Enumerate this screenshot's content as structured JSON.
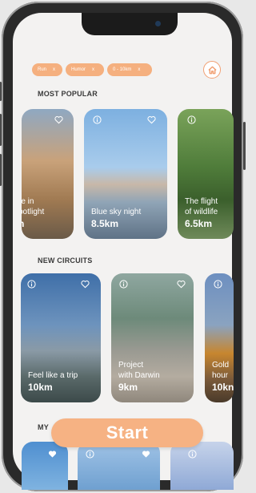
{
  "filters": [
    {
      "label": "Run",
      "x": "x"
    },
    {
      "label": "Humor",
      "x": "x"
    },
    {
      "label": "0 - 10km",
      "x": "x"
    }
  ],
  "sections": {
    "most_popular": "MOST POPULAR",
    "new_circuits": "NEW CIRCUITS",
    "my_partial": "MY"
  },
  "popular": [
    {
      "title_line1": "re in",
      "title_line2": "potlight",
      "distance": "n"
    },
    {
      "title_line1": "Blue sky night",
      "title_line2": "",
      "distance": "8.5km"
    },
    {
      "title_line1": "The flight",
      "title_line2": "of wildlife",
      "distance": "6.5km"
    }
  ],
  "circuits": [
    {
      "title_line1": "Feel like a trip",
      "title_line2": "",
      "distance": "10km"
    },
    {
      "title_line1": "Project",
      "title_line2": "with Darwin",
      "distance": "9km"
    },
    {
      "title_line1": "Gold",
      "title_line2": "hour",
      "distance": "10kn"
    }
  ],
  "start_label": "Start",
  "colors": {
    "accent": "#f5b07f",
    "background": "#f3f2f1"
  }
}
